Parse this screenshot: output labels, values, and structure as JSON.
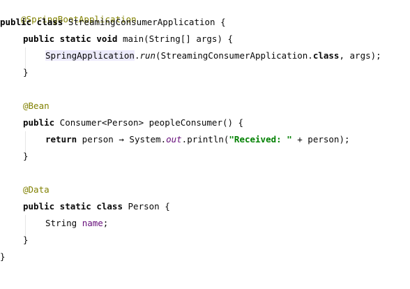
{
  "code": {
    "l1_annotation": "@SpringBootApplication",
    "l2_kw": "public class",
    "l2_name": " StreamingConsumerApplication {",
    "l3_kw": "public static void",
    "l3_rest": " main(String[] args) {",
    "l4_hl": "SpringApplication",
    "l4_dot": ".",
    "l4_run": "run",
    "l4_open": "(StreamingConsumerApplication.",
    "l4_class_kw": "class",
    "l4_close": ", args);",
    "l5_close": "}",
    "l7_annotation": "@Bean",
    "l8_kw": "public",
    "l8_rest": " Consumer<Person> peopleConsumer() {",
    "l9_kw": "return",
    "l9_mid": " person → System.",
    "l9_out": "out",
    "l9_println": ".println(",
    "l9_str": "\"Received: \"",
    "l9_end": " + person);",
    "l10_close": "}",
    "l12_annotation": "@Data",
    "l13_kw": "public static class",
    "l13_rest": " Person {",
    "l14_type": "String ",
    "l14_field": "name",
    "l14_end": ";",
    "l15_close": "}",
    "l16_close": "}"
  },
  "colors": {
    "background": "#ffffff",
    "annotation": "#808000",
    "highlight": "#edebfc",
    "field": "#660e7a",
    "string": "#008000"
  }
}
